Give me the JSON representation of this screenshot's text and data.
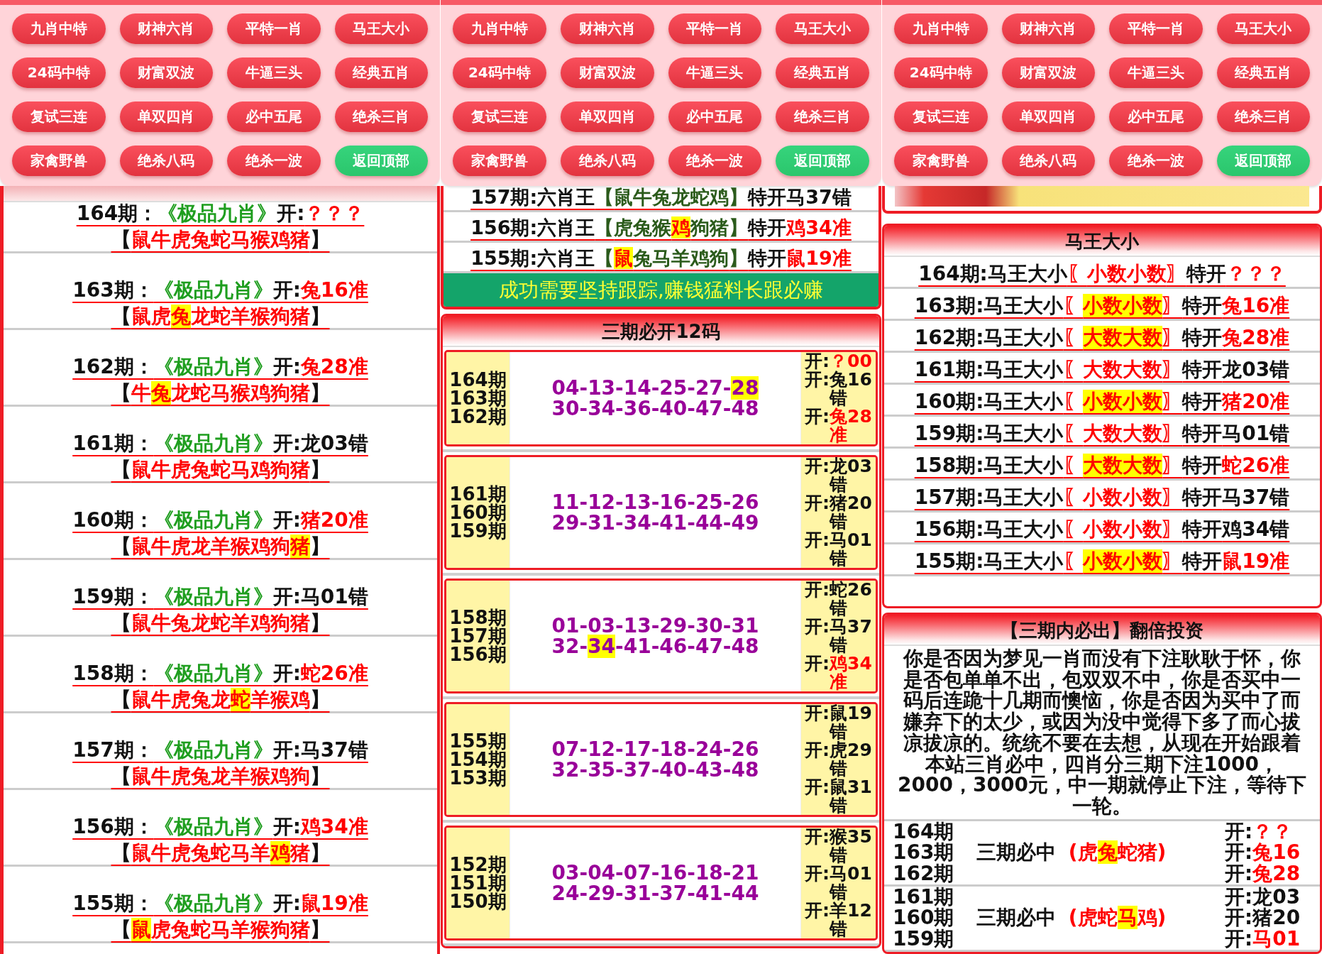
{
  "left_panel": {
    "nav": [
      {
        "label": "九肖中特",
        "kind": "link"
      },
      {
        "label": "财神六肖",
        "kind": "link"
      },
      {
        "label": "平特一肖",
        "kind": "link"
      },
      {
        "label": "马王大小",
        "kind": "link"
      },
      {
        "label": "24码中特",
        "kind": "link"
      },
      {
        "label": "财富双波",
        "kind": "link"
      },
      {
        "label": "牛逼三头",
        "kind": "link"
      },
      {
        "label": "经典五肖",
        "kind": "link"
      },
      {
        "label": "复试三连",
        "kind": "link"
      },
      {
        "label": "单双四肖",
        "kind": "link"
      },
      {
        "label": "必中五尾",
        "kind": "link"
      },
      {
        "label": "绝杀三肖",
        "kind": "link"
      },
      {
        "label": "家禽野兽",
        "kind": "link"
      },
      {
        "label": "绝杀八码",
        "kind": "link"
      },
      {
        "label": "绝杀一波",
        "kind": "link"
      },
      {
        "label": "返回顶部",
        "kind": "top"
      }
    ],
    "rows": [
      {
        "period": "164期：",
        "title": "《极品九肖》",
        "open": "开:",
        "result": "？？？",
        "kind": "pending",
        "brackets": [
          "【",
          "】"
        ],
        "signs": [
          {
            "text": "鼠牛虎兔蛇马猴鸡猪",
            "highlighted": false
          }
        ]
      },
      {
        "period": "163期：",
        "title": "《极品九肖》",
        "open": "开:",
        "result": "兔16准",
        "kind": "hit",
        "brackets": [
          "【",
          "】"
        ],
        "signs": [
          {
            "text": "鼠虎",
            "highlighted": false
          },
          {
            "text": "兔",
            "highlighted": true
          },
          {
            "text": "龙蛇羊猴狗猪",
            "highlighted": false
          }
        ]
      },
      {
        "period": "162期：",
        "title": "《极品九肖》",
        "open": "开:",
        "result": "兔28准",
        "kind": "hit",
        "brackets": [
          "【",
          "】"
        ],
        "signs": [
          {
            "text": "牛",
            "highlighted": false
          },
          {
            "text": "兔",
            "highlighted": true
          },
          {
            "text": "龙蛇马猴鸡狗猪",
            "highlighted": false
          }
        ]
      },
      {
        "period": "161期：",
        "title": "《极品九肖》",
        "open": "开:",
        "result": "龙03错",
        "kind": "miss",
        "brackets": [
          "【",
          "】"
        ],
        "signs": [
          {
            "text": "鼠牛虎兔蛇马鸡狗猪",
            "highlighted": false
          }
        ]
      },
      {
        "period": "160期：",
        "title": "《极品九肖》",
        "open": "开:",
        "result": "猪20准",
        "kind": "hit",
        "brackets": [
          "【",
          "】"
        ],
        "signs": [
          {
            "text": "鼠牛虎龙羊猴鸡狗",
            "highlighted": false
          },
          {
            "text": "猪",
            "highlighted": true
          }
        ]
      },
      {
        "period": "159期：",
        "title": "《极品九肖》",
        "open": "开:",
        "result": "马01错",
        "kind": "miss",
        "brackets": [
          "【",
          "】"
        ],
        "signs": [
          {
            "text": "鼠牛兔龙蛇羊鸡狗猪",
            "highlighted": false
          }
        ]
      },
      {
        "period": "158期：",
        "title": "《极品九肖》",
        "open": "开:",
        "result": "蛇26准",
        "kind": "hit",
        "brackets": [
          "【",
          "】"
        ],
        "signs": [
          {
            "text": "鼠牛虎兔龙",
            "highlighted": false
          },
          {
            "text": "蛇",
            "highlighted": true
          },
          {
            "text": "羊猴鸡",
            "highlighted": false
          }
        ]
      },
      {
        "period": "157期：",
        "title": "《极品九肖》",
        "open": "开:",
        "result": "马37错",
        "kind": "miss",
        "brackets": [
          "【",
          "】"
        ],
        "signs": [
          {
            "text": "鼠牛虎兔龙羊猴鸡狗",
            "highlighted": false
          }
        ]
      },
      {
        "period": "156期：",
        "title": "《极品九肖》",
        "open": "开:",
        "result": "鸡34准",
        "kind": "hit",
        "brackets": [
          "【",
          "】"
        ],
        "signs": [
          {
            "text": "鼠牛虎兔蛇马羊",
            "highlighted": false
          },
          {
            "text": "鸡",
            "highlighted": true
          },
          {
            "text": "猪",
            "highlighted": false
          }
        ]
      },
      {
        "period": "155期：",
        "title": "《极品九肖》",
        "open": "开:",
        "result": "鼠19准",
        "kind": "hit",
        "brackets": [
          "【",
          "】"
        ],
        "signs": [
          {
            "text": "鼠",
            "highlighted": true
          },
          {
            "text": "虎兔蛇马羊猴狗猪",
            "highlighted": false
          }
        ]
      }
    ]
  },
  "middle_panel": {
    "nav": [
      {
        "label": "九肖中特",
        "kind": "link"
      },
      {
        "label": "财神六肖",
        "kind": "link"
      },
      {
        "label": "平特一肖",
        "kind": "link"
      },
      {
        "label": "马王大小",
        "kind": "link"
      },
      {
        "label": "24码中特",
        "kind": "link"
      },
      {
        "label": "财富双波",
        "kind": "link"
      },
      {
        "label": "牛逼三头",
        "kind": "link"
      },
      {
        "label": "经典五肖",
        "kind": "link"
      },
      {
        "label": "复试三连",
        "kind": "link"
      },
      {
        "label": "单双四肖",
        "kind": "link"
      },
      {
        "label": "必中五尾",
        "kind": "link"
      },
      {
        "label": "绝杀三肖",
        "kind": "link"
      },
      {
        "label": "家禽野兽",
        "kind": "link"
      },
      {
        "label": "绝杀八码",
        "kind": "link"
      },
      {
        "label": "绝杀一波",
        "kind": "link"
      },
      {
        "label": "返回顶部",
        "kind": "top"
      }
    ],
    "rows": [
      {
        "period": "157期:六肖王",
        "brackets": [
          "【",
          "】"
        ],
        "signs": [
          {
            "text": "鼠牛兔龙蛇鸡",
            "highlighted": false
          }
        ],
        "open": "特开",
        "result": "马37错",
        "kind": "miss"
      },
      {
        "period": "156期:六肖王",
        "brackets": [
          "【",
          "】"
        ],
        "signs": [
          {
            "text": "虎兔猴",
            "highlighted": false
          },
          {
            "text": "鸡",
            "highlighted": true
          },
          {
            "text": "狗猪",
            "highlighted": false
          }
        ],
        "open": "特开",
        "result": "鸡34准",
        "kind": "hit"
      },
      {
        "period": "155期:六肖王",
        "brackets": [
          "【",
          "】"
        ],
        "signs": [
          {
            "text": "鼠",
            "highlighted": true
          },
          {
            "text": "兔马羊鸡狗",
            "highlighted": false
          }
        ],
        "open": "特开",
        "result": "鼠19准",
        "kind": "hit"
      }
    ],
    "slogan": "成功需要坚持跟踪,赚钱猛料长跟必赚",
    "section": {
      "title": "三期必开12码",
      "cards": [
        {
          "periods": [
            "164期",
            "163期",
            "162期"
          ],
          "lines": [
            [
              {
                "text": "04-13-14-25-27-",
                "highlighted": false
              },
              {
                "text": "28",
                "highlighted": true
              }
            ],
            [
              {
                "text": "30-34-36-40-47-48",
                "highlighted": false
              }
            ]
          ],
          "results": [
            {
              "open": "开:",
              "result": "？00",
              "kind": "pending"
            },
            {
              "open": "开:",
              "result": "兔16错",
              "kind": "miss"
            },
            {
              "open": "开:",
              "result": "兔28准",
              "kind": "hit"
            }
          ]
        },
        {
          "periods": [
            "161期",
            "160期",
            "159期"
          ],
          "lines": [
            [
              {
                "text": "11-12-13-16-25-26",
                "highlighted": false
              }
            ],
            [
              {
                "text": "29-31-34-41-44-49",
                "highlighted": false
              }
            ]
          ],
          "results": [
            {
              "open": "开:",
              "result": "龙03错",
              "kind": "miss"
            },
            {
              "open": "开:",
              "result": "猪20错",
              "kind": "miss"
            },
            {
              "open": "开:",
              "result": "马01错",
              "kind": "miss"
            }
          ]
        },
        {
          "periods": [
            "158期",
            "157期",
            "156期"
          ],
          "lines": [
            [
              {
                "text": "01-03-13-29-30-31",
                "highlighted": false
              }
            ],
            [
              {
                "text": "32-",
                "highlighted": false
              },
              {
                "text": "34",
                "highlighted": true
              },
              {
                "text": "-41-46-47-48",
                "highlighted": false
              }
            ]
          ],
          "results": [
            {
              "open": "开:",
              "result": "蛇26错",
              "kind": "miss"
            },
            {
              "open": "开:",
              "result": "马37错",
              "kind": "miss"
            },
            {
              "open": "开:",
              "result": "鸡34准",
              "kind": "hit"
            }
          ]
        },
        {
          "periods": [
            "155期",
            "154期",
            "153期"
          ],
          "lines": [
            [
              {
                "text": "07-12-17-18-24-26",
                "highlighted": false
              }
            ],
            [
              {
                "text": "32-35-37-40-43-48",
                "highlighted": false
              }
            ]
          ],
          "results": [
            {
              "open": "开:",
              "result": "鼠19错",
              "kind": "miss"
            },
            {
              "open": "开:",
              "result": "虎29错",
              "kind": "miss"
            },
            {
              "open": "开:",
              "result": "鼠31错",
              "kind": "miss"
            }
          ]
        },
        {
          "periods": [
            "152期",
            "151期",
            "150期"
          ],
          "lines": [
            [
              {
                "text": "03-04-07-16-18-21",
                "highlighted": false
              }
            ],
            [
              {
                "text": "24-29-31-37-41-44",
                "highlighted": false
              }
            ]
          ],
          "results": [
            {
              "open": "开:",
              "result": "猴35错",
              "kind": "miss"
            },
            {
              "open": "开:",
              "result": "马01错",
              "kind": "miss"
            },
            {
              "open": "开:",
              "result": "羊12错",
              "kind": "miss"
            }
          ]
        }
      ]
    }
  },
  "right_panel": {
    "nav": [
      {
        "label": "九肖中特",
        "kind": "link"
      },
      {
        "label": "财神六肖",
        "kind": "link"
      },
      {
        "label": "平特一肖",
        "kind": "link"
      },
      {
        "label": "马王大小",
        "kind": "link"
      },
      {
        "label": "24码中特",
        "kind": "link"
      },
      {
        "label": "财富双波",
        "kind": "link"
      },
      {
        "label": "牛逼三头",
        "kind": "link"
      },
      {
        "label": "经典五肖",
        "kind": "link"
      },
      {
        "label": "复试三连",
        "kind": "link"
      },
      {
        "label": "单双四肖",
        "kind": "link"
      },
      {
        "label": "必中五尾",
        "kind": "link"
      },
      {
        "label": "绝杀三肖",
        "kind": "link"
      },
      {
        "label": "家禽野兽",
        "kind": "link"
      },
      {
        "label": "绝杀八码",
        "kind": "link"
      },
      {
        "label": "绝杀一波",
        "kind": "link"
      },
      {
        "label": "返回顶部",
        "kind": "top"
      }
    ],
    "section": {
      "title": "马王大小",
      "rows": [
        {
          "period": "164期:马王大小",
          "brackets": [
            "〖",
            "〗"
          ],
          "pick": {
            "text": "小数小数",
            "highlighted": false
          },
          "open": "特开",
          "result": "？？？",
          "kind": "pending"
        },
        {
          "period": "163期:马王大小",
          "brackets": [
            "〖",
            "〗"
          ],
          "pick": {
            "text": "小数小数",
            "highlighted": true
          },
          "open": "特开",
          "result": "兔16准",
          "kind": "hit"
        },
        {
          "period": "162期:马王大小",
          "brackets": [
            "〖",
            "〗"
          ],
          "pick": {
            "text": "大数大数",
            "highlighted": true
          },
          "open": "特开",
          "result": "兔28准",
          "kind": "hit"
        },
        {
          "period": "161期:马王大小",
          "brackets": [
            "〖",
            "〗"
          ],
          "pick": {
            "text": "大数大数",
            "highlighted": false
          },
          "open": "特开",
          "result": "龙03错",
          "kind": "miss"
        },
        {
          "period": "160期:马王大小",
          "brackets": [
            "〖",
            "〗"
          ],
          "pick": {
            "text": "小数小数",
            "highlighted": true
          },
          "open": "特开",
          "result": "猪20准",
          "kind": "hit"
        },
        {
          "period": "159期:马王大小",
          "brackets": [
            "〖",
            "〗"
          ],
          "pick": {
            "text": "大数大数",
            "highlighted": false
          },
          "open": "特开",
          "result": "马01错",
          "kind": "miss"
        },
        {
          "period": "158期:马王大小",
          "brackets": [
            "〖",
            "〗"
          ],
          "pick": {
            "text": "大数大数",
            "highlighted": true
          },
          "open": "特开",
          "result": "蛇26准",
          "kind": "hit"
        },
        {
          "period": "157期:马王大小",
          "brackets": [
            "〖",
            "〗"
          ],
          "pick": {
            "text": "小数小数",
            "highlighted": false
          },
          "open": "特开",
          "result": "马37错",
          "kind": "miss"
        },
        {
          "period": "156期:马王大小",
          "brackets": [
            "〖",
            "〗"
          ],
          "pick": {
            "text": "小数小数",
            "highlighted": false
          },
          "open": "特开",
          "result": "鸡34错",
          "kind": "miss"
        },
        {
          "period": "155期:马王大小",
          "brackets": [
            "〖",
            "〗"
          ],
          "pick": {
            "text": "小数小数",
            "highlighted": true
          },
          "open": "特开",
          "result": "鼠19准",
          "kind": "hit"
        }
      ]
    },
    "bottom_section": {
      "title": "【三期内必出】翻倍投资",
      "paragraph": "你是否因为梦见一肖而没有下注耿耿于怀，你是否包单单不出，包双双不中，你是否买中一码后连跪十几期而懊恼，你是否因为买中了而嫌弃下的太少，或因为没中觉得下多了而心拔凉拔凉的。统统不要在去想，从现在开始跟着本站三肖必中，四肖分三期下注1000，2000，3000元，中一期就停止下注，等待下一轮。",
      "rows": [
        {
          "periods": [
            "164期",
            "163期",
            "162期"
          ],
          "label": "三期必中",
          "parens": [
            "(",
            ")"
          ],
          "signs": [
            {
              "text": "虎",
              "highlighted": false
            },
            {
              "text": "兔",
              "highlighted": true
            },
            {
              "text": "蛇猪",
              "highlighted": false
            }
          ],
          "results": [
            {
              "open": "开:",
              "result": "？？",
              "kind": "pending"
            },
            {
              "open": "开:",
              "result": "兔16",
              "kind": "hit"
            },
            {
              "open": "开:",
              "result": "兔28",
              "kind": "hit"
            }
          ]
        },
        {
          "periods": [
            "161期",
            "160期",
            "159期"
          ],
          "label": "三期必中",
          "parens": [
            "(",
            ")"
          ],
          "signs": [
            {
              "text": "虎蛇",
              "highlighted": false
            },
            {
              "text": "马",
              "highlighted": true
            },
            {
              "text": "鸡",
              "highlighted": false
            }
          ],
          "results": [
            {
              "open": "开:",
              "result": "龙03",
              "kind": "miss"
            },
            {
              "open": "开:",
              "result": "猪20",
              "kind": "miss"
            },
            {
              "open": "开:",
              "result": "马01",
              "kind": "hit"
            }
          ]
        }
      ]
    }
  }
}
